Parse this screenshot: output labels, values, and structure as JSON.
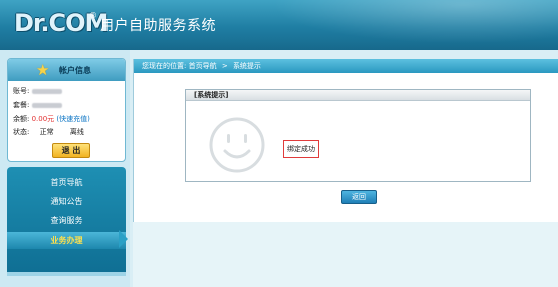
{
  "header": {
    "logo_text": "Dr.COM",
    "logo_mark": "®",
    "system_title": "用户自助服务系统"
  },
  "account": {
    "title": "帐户信息",
    "star_icon": "star-icon",
    "account_label": "账号:",
    "plan_label": "套餐:",
    "balance_label": "余额:",
    "balance_value": "0.00元",
    "recharge_link": "(快速充值)",
    "status_label": "状态:",
    "status_value": "正常",
    "online_state": "离线",
    "exit_button": "退 出"
  },
  "nav": {
    "items": [
      {
        "label": "首页导航"
      },
      {
        "label": "通知公告"
      },
      {
        "label": "查询服务"
      },
      {
        "label": "业务办理"
      }
    ],
    "active_index": 3
  },
  "breadcrumb": {
    "prefix": "您现在的位置:",
    "home": "首页导航",
    "separator": ">",
    "current": "系统提示"
  },
  "message": {
    "header": "[系统提示]",
    "icon": "smiley-icon",
    "text": "绑定成功"
  },
  "actions": {
    "return_button": "返回"
  },
  "colors": {
    "header_blue": "#1f7ea3",
    "nav_blue": "#0f6f94",
    "active_text": "#ffe14d",
    "balance_red": "#e23030",
    "message_border": "#e03b3b"
  }
}
